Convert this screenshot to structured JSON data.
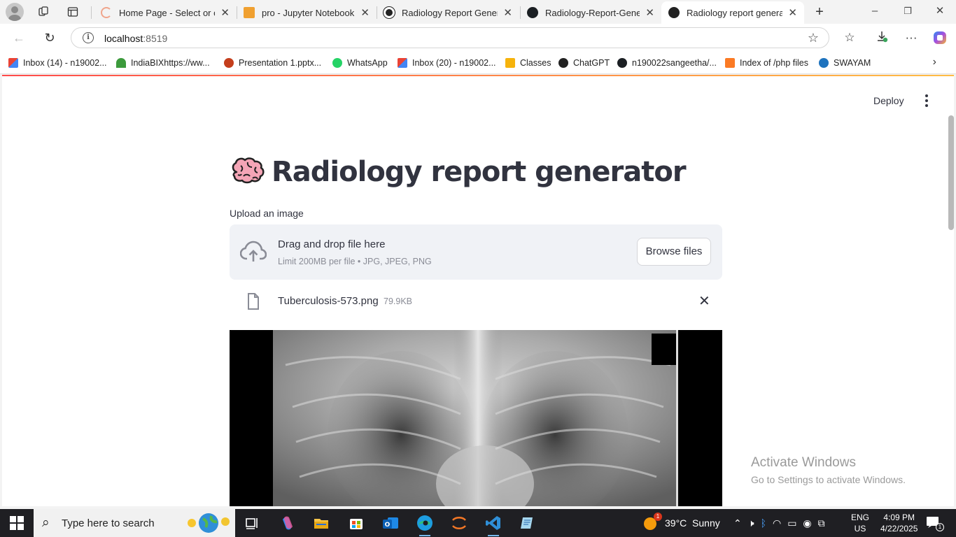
{
  "browser": {
    "tabs": [
      {
        "title": "Home Page - Select or cre",
        "active": false
      },
      {
        "title": "pro - Jupyter Notebook",
        "active": false
      },
      {
        "title": "Radiology Report Generato",
        "active": false
      },
      {
        "title": "Radiology-Report-Generat",
        "active": false
      },
      {
        "title": "Radiology report generato",
        "active": true
      }
    ],
    "url_host": "localhost",
    "url_port": ":8519",
    "bookmarks": [
      "Inbox (14) - n19002...",
      "IndiaBIXhttps://ww...",
      "Presentation 1.pptx...",
      "WhatsApp",
      "Inbox (20) - n19002...",
      "Classes",
      "ChatGPT",
      "n190022sangeetha/...",
      "Index of /php files",
      "SWAYAM"
    ]
  },
  "app": {
    "deploy_label": "Deploy",
    "title": "Radiology report generator",
    "upload_label": "Upload an image",
    "dropzone_title": "Drag and drop file here",
    "dropzone_limit": "Limit 200MB per file • JPG, JPEG, PNG",
    "browse_label": "Browse files",
    "file_name": "Tuberculosis-573.png",
    "file_size": "79.9KB"
  },
  "watermark": {
    "line1": "Activate Windows",
    "line2": "Go to Settings to activate Windows."
  },
  "taskbar": {
    "search_placeholder": "Type here to search",
    "weather": "39°C  Sunny",
    "weather_badge": "1",
    "lang": "ENG",
    "region": "US",
    "time": "4:09 PM",
    "date": "4/22/2025",
    "notification_count": "1"
  },
  "colors": {
    "accent_gradient_start": "#ff4b4b",
    "accent_gradient_end": "#ffbd45",
    "text": "#31333f",
    "dropzone_bg": "#f0f2f6"
  }
}
